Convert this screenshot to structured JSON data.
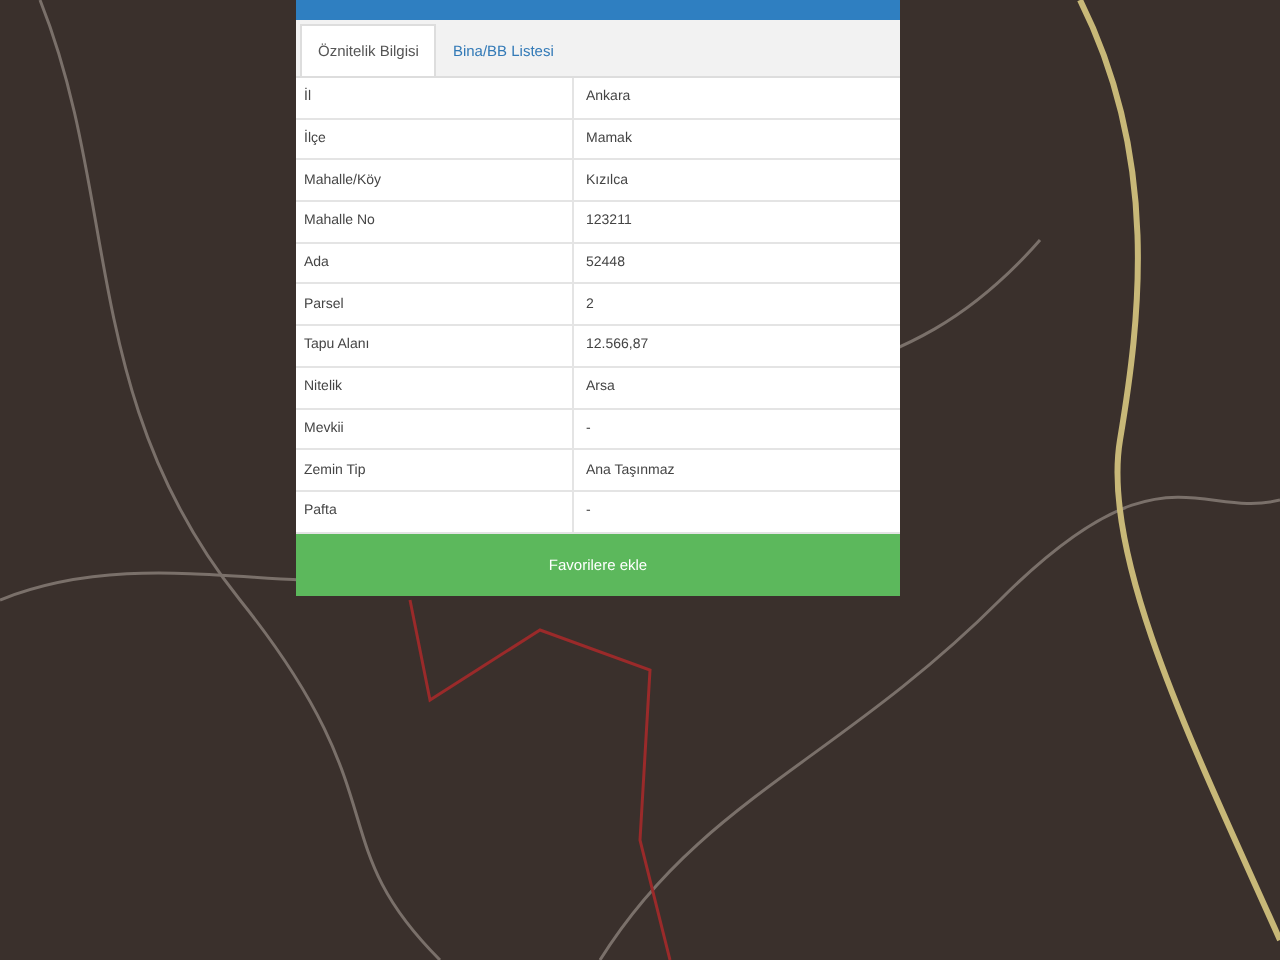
{
  "panel": {
    "tabs": [
      {
        "label": "Öznitelik Bilgisi",
        "selected": true
      },
      {
        "label": "Bina/BB Listesi",
        "selected": false
      }
    ],
    "rows": [
      {
        "label": "İl",
        "value": "Ankara"
      },
      {
        "label": "İlçe",
        "value": "Mamak"
      },
      {
        "label": "Mahalle/Köy",
        "value": "Kızılca"
      },
      {
        "label": "Mahalle No",
        "value": "123211"
      },
      {
        "label": "Ada",
        "value": "52448"
      },
      {
        "label": "Parsel",
        "value": "2"
      },
      {
        "label": "Tapu Alanı",
        "value": "12.566,87"
      },
      {
        "label": "Nitelik",
        "value": "Arsa"
      },
      {
        "label": "Mevkii",
        "value": "-"
      },
      {
        "label": "Zemin Tip",
        "value": "Ana Taşınmaz"
      },
      {
        "label": "Pafta",
        "value": "-"
      }
    ],
    "button": "Favorilere ekle"
  }
}
